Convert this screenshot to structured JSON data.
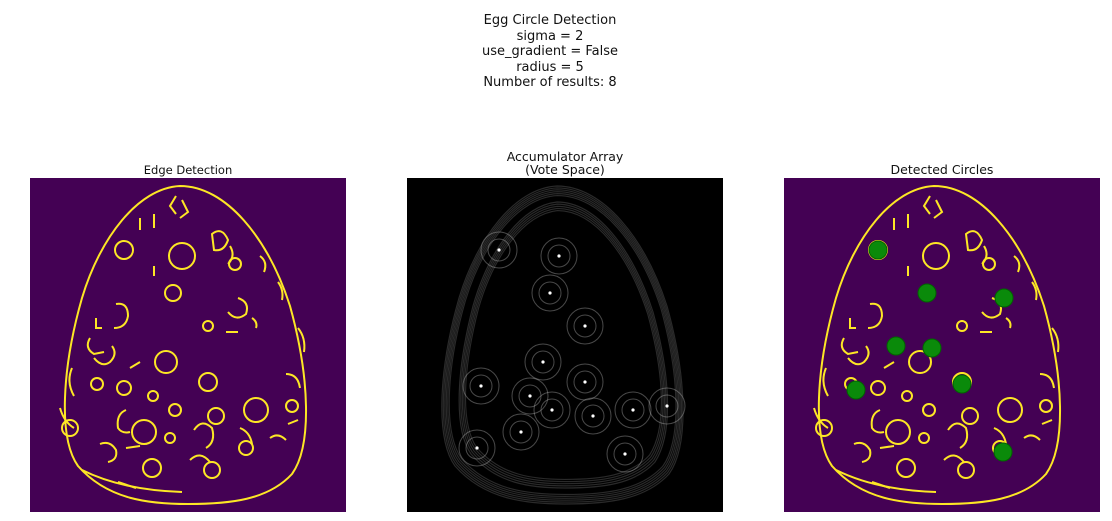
{
  "figure": {
    "title_lines": [
      "Egg Circle Detection",
      "sigma = 2",
      "use_gradient = False",
      "radius = 5",
      "Number of results: 8"
    ]
  },
  "panels": [
    {
      "title": "Edge Detection",
      "background": "#440154",
      "edge_color": "#fde725"
    },
    {
      "title_lines": [
        "Accumulator Array",
        "(Vote Space)"
      ],
      "background": "#000000"
    },
    {
      "title": "Detected Circles",
      "background": "#440154",
      "edge_color": "#fde725",
      "marker_color": "#008000"
    }
  ],
  "colors": {
    "viridis_low": "#440154",
    "viridis_high": "#fde725",
    "detection": "#008000"
  }
}
